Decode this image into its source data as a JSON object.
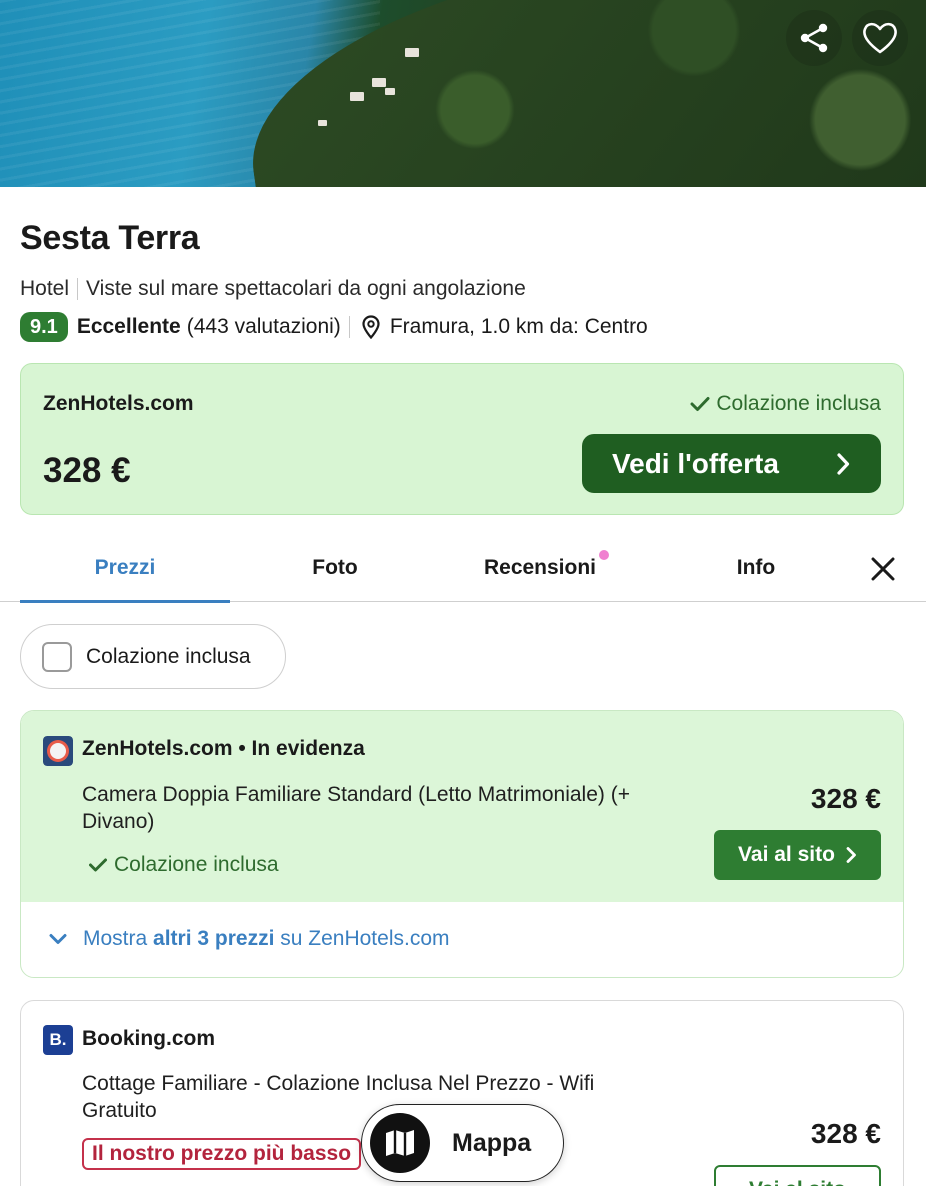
{
  "hotel": {
    "name": "Sesta Terra",
    "type": "Hotel",
    "tagline": "Viste sul mare spettacolari da ogni angolazione",
    "score": "9.1",
    "rating_label": "Eccellente",
    "rating_count": "(443 valutazioni)",
    "location": "Framura, 1.0 km da: Centro"
  },
  "top_offer": {
    "provider": "ZenHotels.com",
    "perk": "Colazione inclusa",
    "price": "328 €",
    "cta_label": "Vedi l'offerta"
  },
  "tabs": [
    {
      "label": "Prezzi",
      "active": true
    },
    {
      "label": "Foto",
      "active": false
    },
    {
      "label": "Recensioni",
      "active": false,
      "has_dot": true
    },
    {
      "label": "Info",
      "active": false
    }
  ],
  "filter": {
    "label": "Colazione inclusa",
    "checked": false
  },
  "offers": [
    {
      "provider": "ZenHotels.com",
      "badge": "• In evidenza",
      "room": "Camera Doppia Familiare Standard (Letto Matrimoniale) (+ Divano)",
      "perk": "Colazione inclusa",
      "price": "328 €",
      "cta_label": "Vai al sito",
      "more_prefix": "Mostra",
      "more_bold": "altri 3 prezzi",
      "more_suffix": "su ZenHotels.com"
    },
    {
      "provider": "Booking.com",
      "logo_letter": "B.",
      "room": "Cottage Familiare - Colazione Inclusa Nel Prezzo - Wifi Gratuito",
      "label": "Il nostro prezzo più basso",
      "price": "328 €",
      "cta_label": "Vai al sito"
    }
  ],
  "map_button": {
    "label": "Mappa"
  },
  "colors": {
    "brand_green": "#2e7d32",
    "dark_green": "#1f5e21",
    "light_green_bg": "#d8f5d3",
    "accent_blue": "#3a7fc0",
    "alert_red": "#c4314b"
  },
  "icons": [
    "share-icon",
    "heart-icon",
    "location-pin-icon",
    "check-icon",
    "chevron-right-icon",
    "close-icon",
    "chevron-down-icon",
    "map-icon"
  ]
}
